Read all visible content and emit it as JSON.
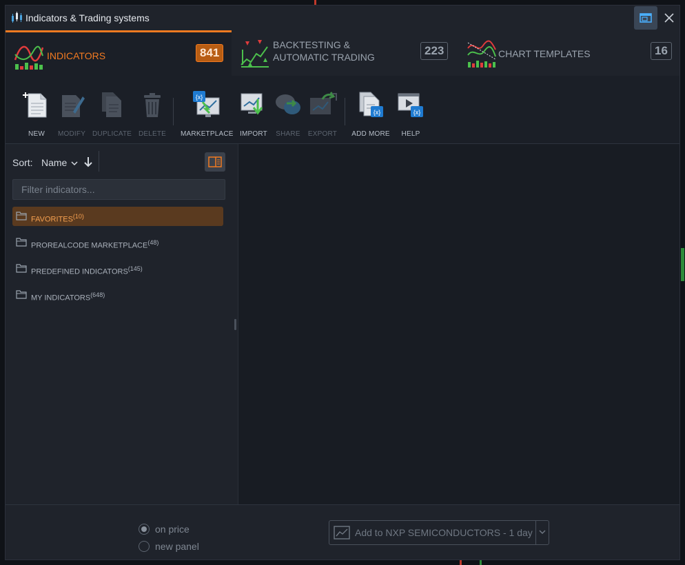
{
  "window": {
    "title": "Indicators & Trading systems"
  },
  "tabs": [
    {
      "label": "INDICATORS",
      "count": "841"
    },
    {
      "label_line1": "BACKTESTING &",
      "label_line2": "AUTOMATIC TRADING",
      "count": "223"
    },
    {
      "label": "CHART TEMPLATES",
      "count": "16"
    }
  ],
  "toolbar": {
    "new": "NEW",
    "modify": "MODIFY",
    "duplicate": "DUPLICATE",
    "delete": "DELETE",
    "marketplace": "MARKETPLACE",
    "import": "IMPORT",
    "share": "SHARE",
    "export": "EXPORT",
    "add_more": "ADD MORE",
    "help": "HELP"
  },
  "sidebar": {
    "sort_label": "Sort:",
    "sort_value": "Name",
    "filter_placeholder": "Filter indicators...",
    "folders": [
      {
        "label": "FAVORITES",
        "count": "(10)"
      },
      {
        "label": "PROREALCODE MARKETPLACE",
        "count": "(48)"
      },
      {
        "label": "PREDEFINED INDICATORS",
        "count": "(145)"
      },
      {
        "label": "MY INDICATORS",
        "count": "(648)"
      }
    ]
  },
  "footer": {
    "radio_on_price": "on price",
    "radio_new_panel": "new panel",
    "add_button": "Add to NXP SEMICONDUCTORS - 1 day"
  },
  "colors": {
    "accent": "#f27a21",
    "window_bg": "#1b1f27",
    "panel_bg": "#1f232b"
  }
}
